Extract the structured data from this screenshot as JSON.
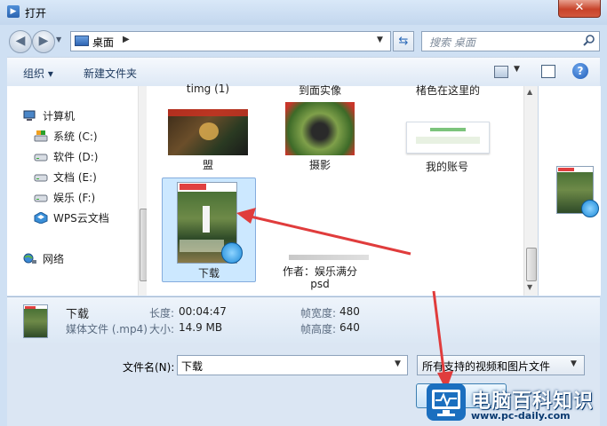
{
  "window": {
    "title": "打开",
    "close_label": "✕"
  },
  "address": {
    "location": "桌面",
    "search_placeholder": "搜索 桌面"
  },
  "toolbar": {
    "organize_label": "组织 ▾",
    "new_folder_label": "新建文件夹",
    "help_label": "?"
  },
  "nav": {
    "items": [
      {
        "label": "计算机",
        "icon": "computer-icon"
      },
      {
        "label": "系统 (C:)",
        "icon": "system-drive-icon"
      },
      {
        "label": "软件 (D:)",
        "icon": "drive-icon"
      },
      {
        "label": "文档 (E:)",
        "icon": "drive-icon"
      },
      {
        "label": "娱乐 (F:)",
        "icon": "drive-icon"
      },
      {
        "label": "WPS云文档",
        "icon": "wps-cloud-icon"
      },
      {
        "label": "网络",
        "icon": "network-icon"
      }
    ]
  },
  "files": {
    "partial_top": [
      "timg (1)",
      "到面实像",
      "楮色在这里的"
    ],
    "items": [
      {
        "label": "盟",
        "selected": false
      },
      {
        "label": "摄影",
        "selected": false
      },
      {
        "label": "我的账号",
        "selected": false
      },
      {
        "label": "下载",
        "selected": true
      },
      {
        "label": "作者：娱乐满分",
        "label2": "psd",
        "selected": false
      }
    ]
  },
  "details": {
    "name": "下载",
    "type": "媒体文件 (.mp4)",
    "length_label": "长度:",
    "length_value": "00:04:47",
    "size_label": "大小:",
    "size_value": "14.9 MB",
    "width_label": "帧宽度:",
    "width_value": "480",
    "height_label": "帧高度:",
    "height_value": "640"
  },
  "bottom": {
    "filename_label": "文件名(N):",
    "filename_value": "下载",
    "filter_value": "所有支持的视频和图片文件"
  },
  "watermark": {
    "title": "电脑百科知识",
    "url": "www.pc-daily.com"
  },
  "colors": {
    "arrow": "#e03c3c",
    "selection": "#cce8ff",
    "accent": "#1b6fbf"
  }
}
